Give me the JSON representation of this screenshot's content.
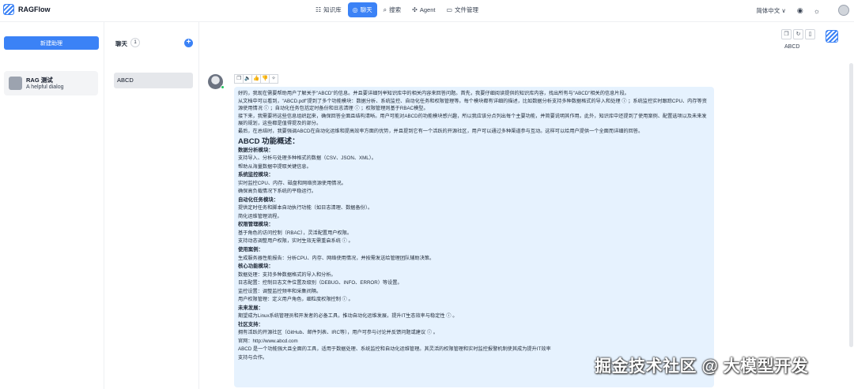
{
  "header": {
    "app_name": "RAGFlow",
    "nav": [
      {
        "icon": "☷",
        "label": "知识库"
      },
      {
        "icon": "◎",
        "label": "聊天"
      },
      {
        "icon": "⌕",
        "label": "搜索"
      },
      {
        "icon": "✣",
        "label": "Agent"
      },
      {
        "icon": "▭",
        "label": "文件管理"
      }
    ],
    "language": "简体中文 ∨",
    "github_icon": "◉",
    "theme_icon": "☼"
  },
  "assistants": {
    "new_button": "新建助理",
    "items": [
      {
        "name": "RAG 测试",
        "description": "A helpful dialog"
      }
    ]
  },
  "chats": {
    "title": "聊天",
    "count": "1",
    "add_icon": "+",
    "items": [
      {
        "name": "ABCD"
      }
    ]
  },
  "main": {
    "conversation_title": "ABCD",
    "top_actions": [
      "❐",
      "↻",
      "▯"
    ],
    "message_tools": [
      "❐",
      "🔈",
      "👍",
      "👎",
      "✧"
    ],
    "message": {
      "p1": "好的，我现在需要帮助用户了解关于\"ABCD\"的信息。并且要详细列举知识库中的相关内容来回答问题。首先，我要仔细阅读提供的知识库内容，找出所有与\"ABCD\"相关的信息片段。",
      "p2": "从文档中可以看到，\"ABCD.pdf\"提到了多个功能模块：数据分析、系统监控、自动化任务和权限管理等。每个模块都有详细的描述，比如数据分析支持多种数据格式的导入和处理 ⓘ ；系统监控实时跟踪CPU、内存等资源使用情况 ⓘ ；自动化任务包括定时备份和日志清理 ⓘ ；权限管理则基于RBAC模型。",
      "p3": "接下来，我需要将这些信息组织起来，确保回答全面且结构清晰。用户可能对ABCD的功能模块感兴趣，所以我应该分点列出每个主要功能，并简要说明其作用。此外，知识库中还提到了使用案例、配置选项以及未来发展的规划，这些都是值得提及的部分。",
      "p4": "最后，在总结时，我要强调ABCD在自动化运维和提高效率方面的优势，并且提到它有一个活跃的开源社区，用户可以通过多种渠道参与互动。这样可以给用户提供一个全面而详细的回答。",
      "heading": "ABCD 功能概述：",
      "sections": [
        {
          "title": "数据分析模块：",
          "lines": [
            "支持导入、分析与处理多种格式的数据（CSV、JSON、XML）。",
            "帮助从海量数据中提取关键信息。"
          ]
        },
        {
          "title": "系统监控模块：",
          "lines": [
            "实时监控CPU、内存、磁盘和网络资源使用情况。",
            "确保高负载情况下系统的平稳运行。"
          ]
        },
        {
          "title": "自动化任务模块：",
          "lines": [
            "提供定时任务和脚本自动执行功能（如日志清理、数据备份）。",
            "简化运维管理流程。"
          ]
        },
        {
          "title": "权限管理模块：",
          "lines": [
            "基于角色的访问控制（RBAC），灵活配置用户权限。",
            "支持动态调整用户权限，实时生效无需重启系统 ⓘ 。"
          ]
        },
        {
          "title": "使用案例：",
          "lines": [
            "生成服务器性能报告：分析CPU、内存、网络使用情况，并按需发送给管理团队辅助决策。"
          ]
        },
        {
          "title": "核心功能模块：",
          "lines": [
            "数据处理：支持多种数据格式的导入和分析。",
            "日志配置：控制日志文件位置及级别（DEBUG、INFO、ERROR）等设置。",
            "监控设置：调整监控频率和采集间隔。",
            "用户权限管理：定义用户角色，细粒度权限控制 ⓘ 。"
          ]
        },
        {
          "title": "未来发展：",
          "lines": [
            "期望成为Linux系统管理员和开发者的必备工具，推动自动化运维发展，提升IT生态效率与稳定性 ⓘ 。"
          ]
        },
        {
          "title": "社区支持：",
          "lines": [
            "拥有活跃的开源社区（GitHub、邮件列表、IRC等），用户可参与讨论并反馈问题或建议 ⓘ 。",
            "官网：http://www.abcd.com",
            "ABCD 是一个功能强大且全面的工具，适用于数据处理、系统监控和自动化运维管理。其灵活的权限管理和实时监控报警机制使其成为提升IT效率",
            "支持与合作。"
          ]
        }
      ]
    }
  },
  "watermark": "掘金技术社区 @ 大模型开发",
  "colors": {
    "accent": "#3b82f6",
    "bubble": "#e6f2fe"
  }
}
